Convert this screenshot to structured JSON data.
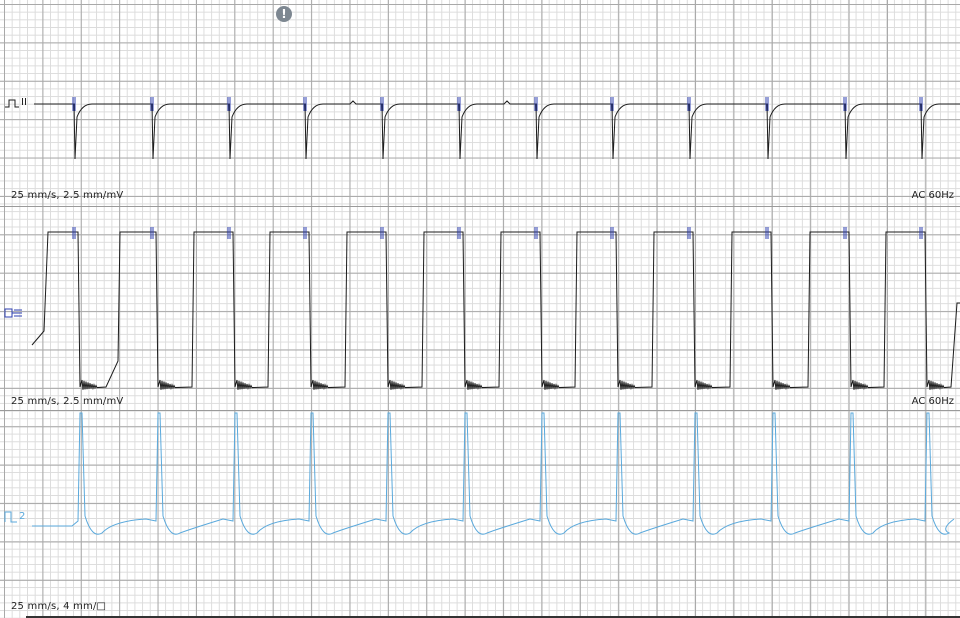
{
  "panels": [
    {
      "id": "lead-ii",
      "lead_label": "II",
      "label_icon": "pacing-square-icon",
      "speed_gain": "25 mm/s, 2.5 mm/mV",
      "filter": "AC 60Hz",
      "trace_color": "#1c1c1c",
      "marker_color": "#2e3fb0"
    },
    {
      "id": "lead-2",
      "lead_label": "",
      "label_icon": "lead-selector-icon",
      "speed_gain": "25 mm/s, 2.5 mm/mV",
      "filter": "AC 60Hz",
      "trace_color": "#1c1c1c",
      "marker_color": "#2e3fb0"
    },
    {
      "id": "pressure",
      "lead_label": "2",
      "label_icon": "pressure-channel-icon",
      "speed_gain": "25 mm/s, 4 mm/□",
      "filter": "",
      "trace_color": "#5aa9dc",
      "marker_color": "#5aa9dc"
    }
  ],
  "alert_icon": "exclamation-circle-icon",
  "alert_glyph": "!",
  "beat_count": 12
}
